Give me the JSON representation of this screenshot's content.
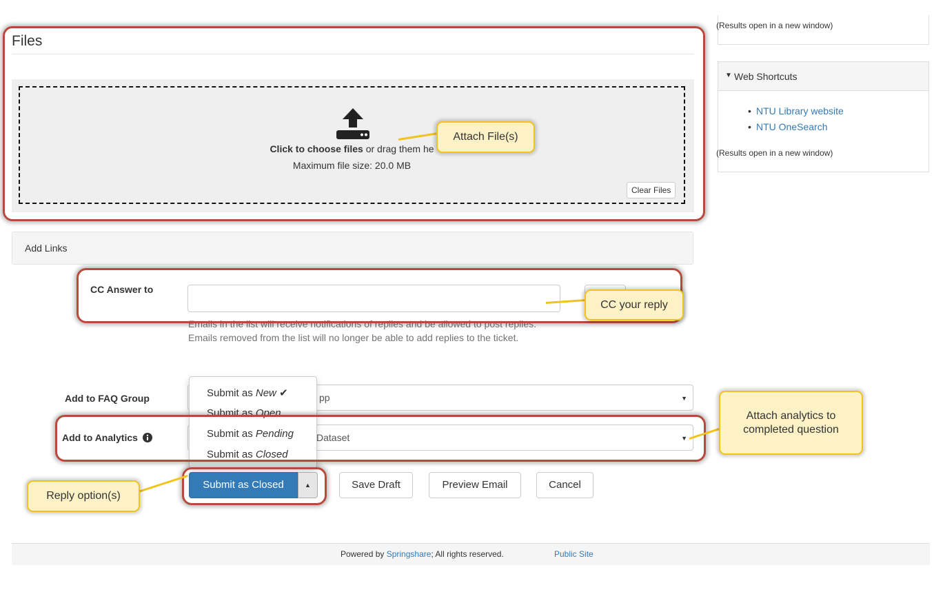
{
  "files": {
    "title": "Files",
    "drop_strong": "Click to choose files",
    "drop_rest": " or drag them he",
    "max_size": "Maximum file size: 20.0 MB",
    "clear_label": "Clear Files"
  },
  "sidebar": {
    "top_note": "(Results open in a new window)",
    "web_shortcuts": {
      "heading": "Web Shortcuts",
      "links": [
        "NTU Library website",
        "NTU OneSearch"
      ],
      "note": "(Results open in a new window)"
    }
  },
  "add_links": {
    "label": "Add Links"
  },
  "cc": {
    "label": "CC Answer to",
    "value": "",
    "help": "Emails in the list will receive notifications of replies and be allowed to post replies. Emails removed from the list will no longer be able to add replies to the ticket."
  },
  "faq_group": {
    "label": "Add to FAQ Group",
    "selected": "pp"
  },
  "analytics": {
    "label": "Add to Analytics",
    "selected": "Dataset"
  },
  "submit_menu": {
    "items": [
      {
        "prefix": "Submit as ",
        "state": "New",
        "checked": true
      },
      {
        "prefix": "Submit as ",
        "state": "Open",
        "checked": false
      },
      {
        "prefix": "Submit as ",
        "state": "Pending",
        "checked": false
      },
      {
        "prefix": "Submit as ",
        "state": "Closed",
        "checked": false
      }
    ]
  },
  "actions": {
    "submit_label": "Submit as Closed",
    "save_draft": "Save Draft",
    "preview_email": "Preview Email",
    "cancel": "Cancel"
  },
  "footer": {
    "powered_prefix": "Powered by ",
    "springshare": "Springshare",
    "rights": "; All rights reserved.",
    "public_site": "Public Site"
  },
  "callouts": {
    "attach_files": "Attach File(s)",
    "cc_reply": "CC your reply",
    "analytics": "Attach analytics to completed question",
    "reply_options": "Reply option(s)"
  },
  "colors": {
    "primary": "#337ab7",
    "highlight_border": "#b7493d",
    "callout_fill": "#fdf1c6",
    "callout_border": "#f2c31c"
  }
}
